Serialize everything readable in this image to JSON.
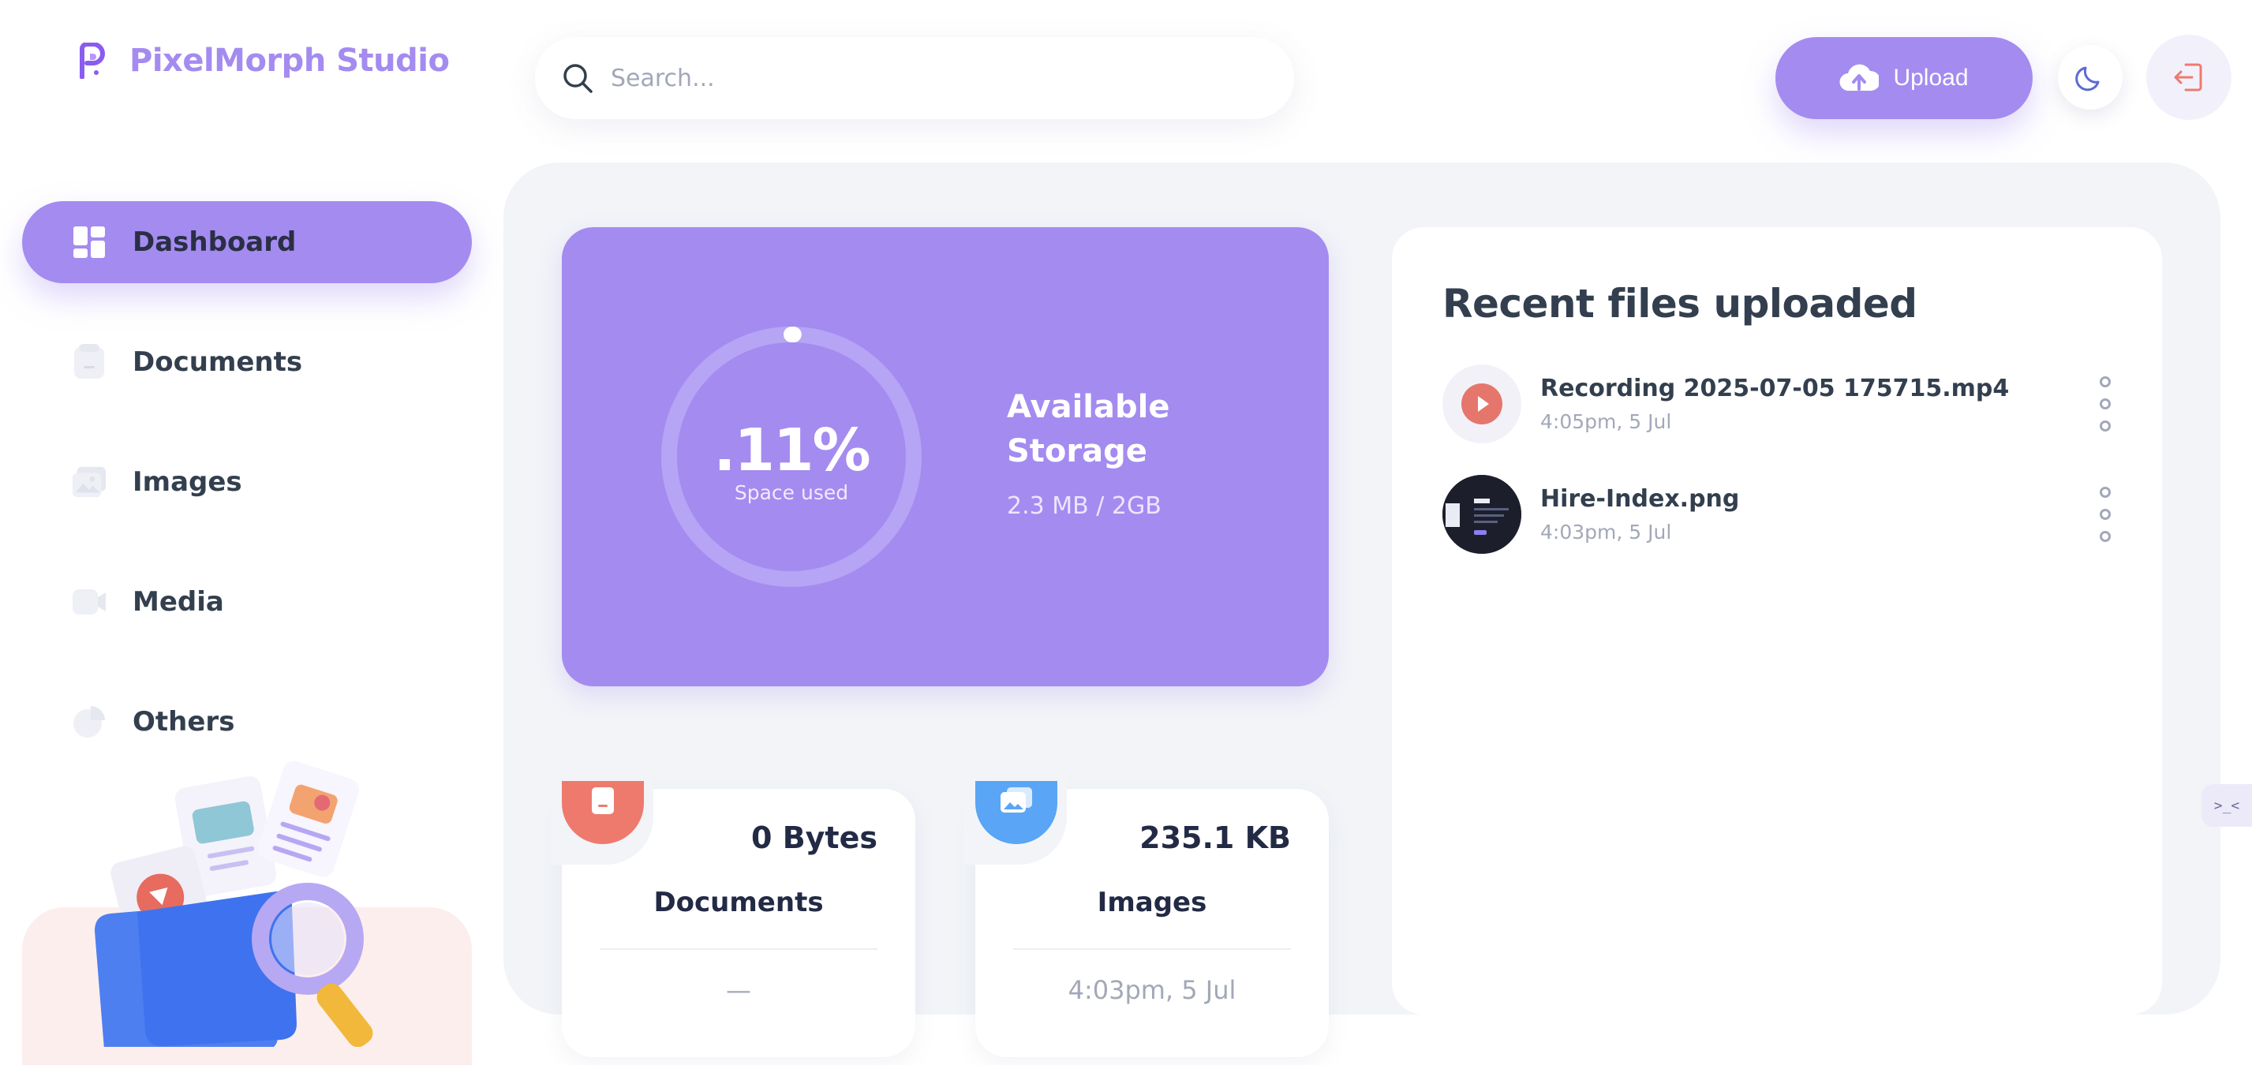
{
  "app": {
    "title": "PixelMorph Studio"
  },
  "sidebar": {
    "items": [
      {
        "label": "Dashboard",
        "icon": "dashboard-icon",
        "active": true
      },
      {
        "label": "Documents",
        "icon": "document-icon",
        "active": false
      },
      {
        "label": "Images",
        "icon": "image-icon",
        "active": false
      },
      {
        "label": "Media",
        "icon": "video-icon",
        "active": false
      },
      {
        "label": "Others",
        "icon": "pie-chart-icon",
        "active": false
      }
    ]
  },
  "header": {
    "search": {
      "placeholder": "Search...",
      "value": ""
    },
    "upload_label": "Upload"
  },
  "storage": {
    "percent_label": ".11%",
    "percent_fraction": 0.0011,
    "sub_label": "Space used",
    "title": "Available Storage",
    "usage": "2.3 MB / 2GB"
  },
  "types": [
    {
      "name": "Documents",
      "size": "0 Bytes",
      "updated": "—",
      "color": "#ee7a6e",
      "icon": "document-icon"
    },
    {
      "name": "Images",
      "size": "235.1 KB",
      "updated": "4:03pm, 5 Jul",
      "color": "#5aa5f5",
      "icon": "image-icon"
    }
  ],
  "recent": {
    "title": "Recent files uploaded",
    "files": [
      {
        "name": "Recording 2025-07-05 175715.mp4",
        "time": "4:05pm, 5 Jul",
        "kind": "video"
      },
      {
        "name": "Hire-Index.png",
        "time": "4:03pm, 5 Jul",
        "kind": "image"
      }
    ]
  },
  "colors": {
    "accent": "#a48bf0",
    "panel_bg": "#f2f4f8",
    "text": "#333f4e",
    "muted": "#a3a8b8",
    "danger": "#ee7a6e",
    "info": "#5aa5f5"
  }
}
